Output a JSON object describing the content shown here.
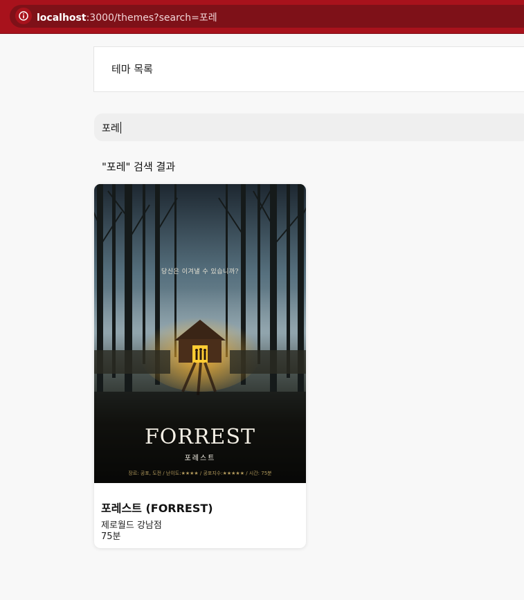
{
  "browser": {
    "url_host": "localhost",
    "url_rest": ":3000/themes?search=포레"
  },
  "header": {
    "title": "테마 목록"
  },
  "search": {
    "value": "포레"
  },
  "results": {
    "heading": "\"포레\" 검색 결과",
    "items": [
      {
        "title": "포레스트 (FORREST)",
        "branch": "제로월드 강남점",
        "duration": "75분",
        "poster": {
          "tagline": "당신은 이겨낼 수 있습니까?",
          "logo": "FORREST",
          "sublogo": "포레스트",
          "info": "장르: 공포, 도전 / 난이도:★★★★ / 공포지수:★★★★★ / 시간: 75분"
        }
      }
    ]
  },
  "colors": {
    "browser_bar": "#a8121c",
    "address_pill": "#7e1118",
    "page_bg": "#f8f8f8",
    "cabin_light": "#ffcc33"
  }
}
